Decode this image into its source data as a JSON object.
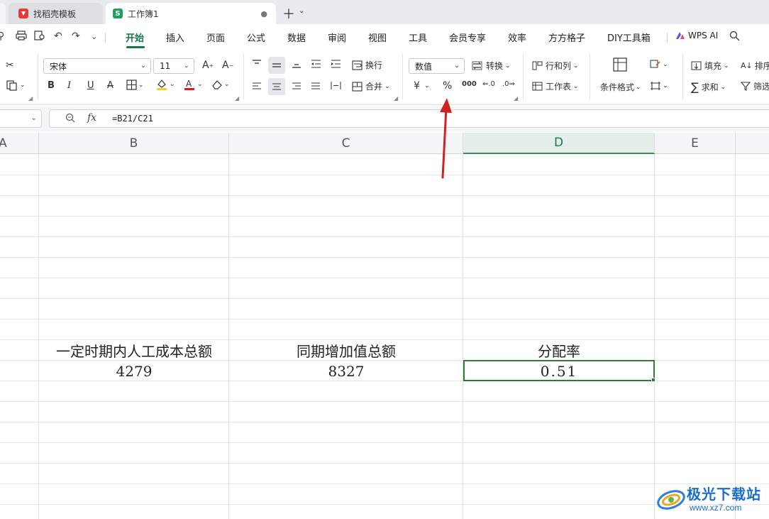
{
  "tabs": [
    {
      "label": "找稻壳模板",
      "icon": "docer-icon"
    },
    {
      "label": "工作簿1",
      "icon": "sheet-icon",
      "icon_letter": "S",
      "active": true
    }
  ],
  "menu": {
    "items": [
      "开始",
      "插入",
      "页面",
      "公式",
      "数据",
      "审阅",
      "视图",
      "工具",
      "会员专享",
      "效率",
      "方方格子",
      "DIY工具箱"
    ],
    "active": "开始",
    "wps_ai": "WPS AI"
  },
  "ribbon": {
    "font_name": "宋体",
    "font_size": "11",
    "wrap_label": "换行",
    "merge_label": "合并",
    "number_format": "数值",
    "convert_label": "转换",
    "percent_symbol": "%",
    "rowcol_label": "行和列",
    "worksheet_label": "工作表",
    "cond_format_label": "条件格式",
    "fill_label": "填充",
    "sort_label": "排序",
    "sum_label": "求和",
    "filter_label": "筛选"
  },
  "formula_bar": {
    "fx": "fx",
    "formula": "=B21/C21"
  },
  "sheet": {
    "columns": [
      "A",
      "B",
      "C",
      "D",
      "E"
    ],
    "selected_column": "D",
    "header_row": [
      "一定时期内人工成本总额",
      "同期增加值总额",
      "分配率"
    ],
    "value_row": [
      "4279",
      "8327",
      "0.51"
    ]
  },
  "watermark": {
    "name": "极光下载站",
    "url": "www.xz7.com"
  },
  "colors": {
    "accent": "#11794b",
    "selection": "#2e7d32",
    "arrow": "#d0221f"
  }
}
